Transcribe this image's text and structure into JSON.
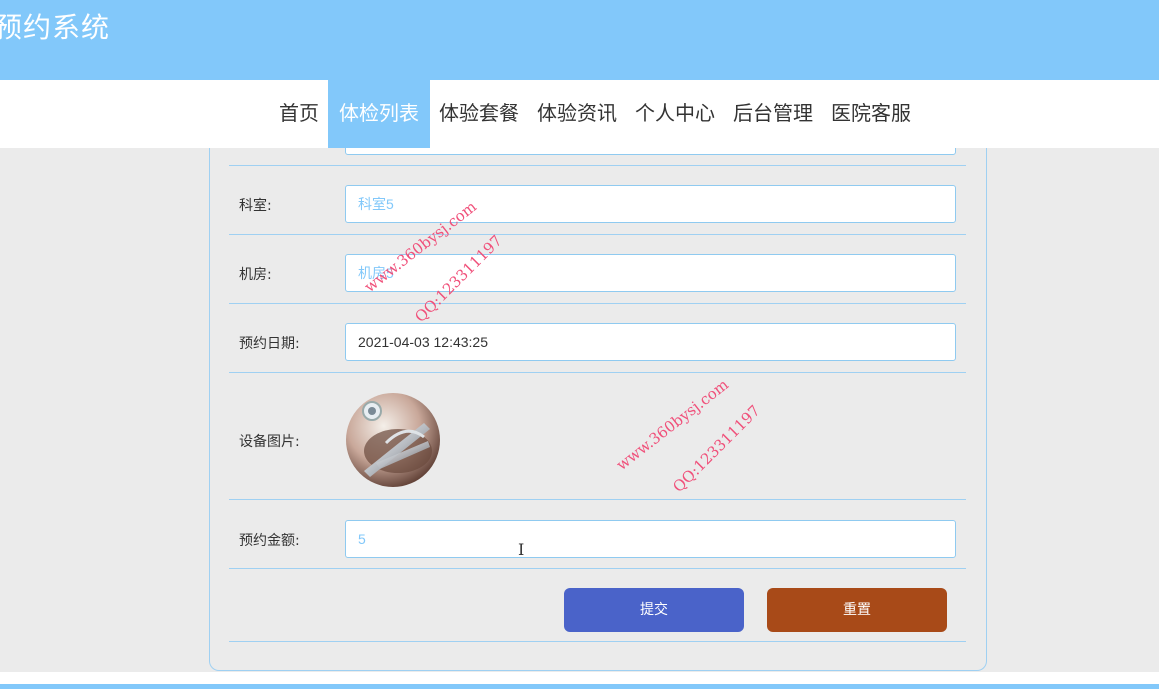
{
  "header": {
    "title": "预约系统"
  },
  "nav": {
    "items": [
      "首页",
      "体检列表",
      "体验套餐",
      "体验资讯",
      "个人中心",
      "后台管理",
      "医院客服"
    ],
    "active_index": 1
  },
  "form": {
    "department": {
      "label": "科室:",
      "value": "科室5"
    },
    "machine_room": {
      "label": "机房:",
      "value": "机房5"
    },
    "booking_date": {
      "label": "预约日期:",
      "value": "2021-04-03 12:43:25"
    },
    "device_image": {
      "label": "设备图片:"
    },
    "booking_amount": {
      "label": "预约金额:",
      "value": "5"
    },
    "submit_label": "提交",
    "reset_label": "重置"
  },
  "watermarks": {
    "site": "www.360bysj.com",
    "qq": "QQ:123311197"
  },
  "colors": {
    "header_bg": "#82c8fa",
    "submit_bg": "#4a63c9",
    "reset_bg": "#a84a18",
    "watermark": "#f0507a"
  }
}
